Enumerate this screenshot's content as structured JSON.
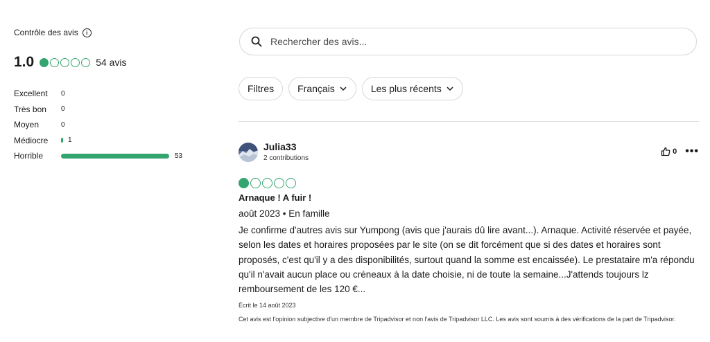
{
  "summary": {
    "title": "Contrôle des avis",
    "score": "1.0",
    "rating": 1,
    "review_count": "54 avis",
    "distribution": [
      {
        "label": "Excellent",
        "count": "0",
        "fraction": 0
      },
      {
        "label": "Très bon",
        "count": "0",
        "fraction": 0
      },
      {
        "label": "Moyen",
        "count": "0",
        "fraction": 0
      },
      {
        "label": "Médiocre",
        "count": "1",
        "fraction": 0.0189
      },
      {
        "label": "Horrible",
        "count": "53",
        "fraction": 1.0
      }
    ]
  },
  "search": {
    "placeholder": "Rechercher des avis..."
  },
  "filters": {
    "filters_label": "Filtres",
    "language_label": "Français",
    "sort_label": "Les plus récents"
  },
  "review": {
    "author": "Julia33",
    "contributions": "2 contributions",
    "likes": "0",
    "rating": 1,
    "title": "Arnaque ! A fuir !",
    "meta": "août 2023 • En famille",
    "body": "Je confirme d'autres avis sur Yumpong (avis que j'aurais dû lire avant...). Arnaque. Activité réservée et payée, selon les dates et horaires proposées par le site (on se dit forcément que si des dates et horaires sont proposés, c'est qu'il y a des disponibilités, surtout quand la somme est encaissée). Le prestataire m'a répondu qu'il n'avait aucun place ou créneaux à la date choisie, ni de toute la semaine...J'attends toujours lz remboursement de les 120 €...",
    "written": "Écrit le 14 août 2023",
    "disclaimer": "Cet avis est l'opinion subjective d'un membre de Tripadvisor et non l'avis de Tripadvisor LLC. Les avis sont soumis à des vérifications de la part de Tripadvisor."
  },
  "colors": {
    "accent": "#34a56f",
    "border": "#d6d6d6"
  },
  "icons": {
    "info": "info-icon",
    "search": "search-icon",
    "chevron": "chevron-down-icon",
    "thumb": "thumbs-up-icon",
    "more": "more-icon"
  }
}
